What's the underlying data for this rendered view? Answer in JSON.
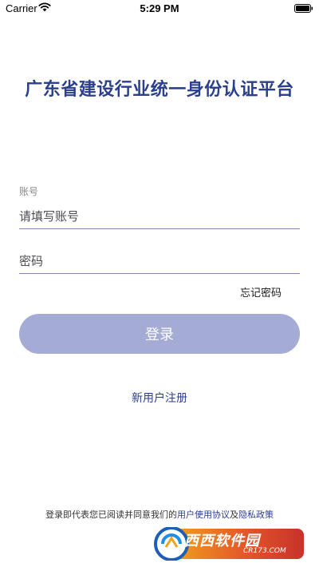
{
  "status_bar": {
    "carrier": "Carrier",
    "time": "5:29 PM"
  },
  "title": "广东省建设行业统一身份认证平台",
  "account": {
    "caption": "账号",
    "placeholder": "请填写账号"
  },
  "password": {
    "placeholder": "密码"
  },
  "forgot_password": "忘记密码",
  "login_button": "登录",
  "register": "新用户注册",
  "agreement": {
    "prefix": "登录即代表您已阅读并同意我们的",
    "user_agreement": "用户使用协议",
    "and": "及",
    "privacy_policy": "隐私政策"
  },
  "watermark": {
    "brand": "西西软件园",
    "site": "CR173.COM"
  },
  "colors": {
    "title": "#2a3f8d",
    "button": "#a4abd4",
    "link": "#2a3f8d"
  }
}
